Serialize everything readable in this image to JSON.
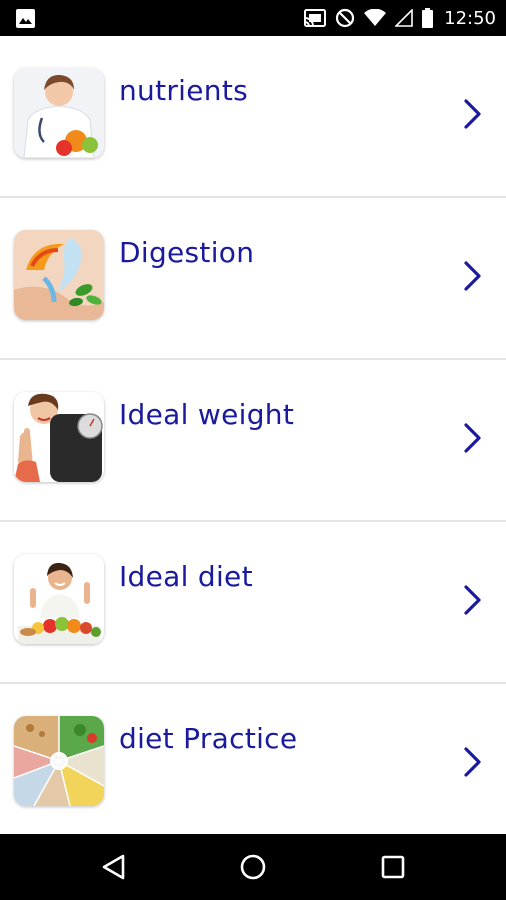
{
  "status_bar": {
    "time": "12:50",
    "icons": [
      "image-notification-icon",
      "cast-icon",
      "do-not-disturb-icon",
      "wifi-icon",
      "signal-icon",
      "battery-icon"
    ]
  },
  "list": {
    "items": [
      {
        "label": "nutrients",
        "icon": "doctor-fruit-icon"
      },
      {
        "label": "Digestion",
        "icon": "digestion-icon"
      },
      {
        "label": "Ideal weight",
        "icon": "weight-scale-icon"
      },
      {
        "label": "Ideal diet",
        "icon": "diet-woman-icon"
      },
      {
        "label": "diet Practice",
        "icon": "food-collage-icon"
      }
    ],
    "accent_color": "#1a1a9e"
  },
  "nav_bar": {
    "buttons": [
      "back-icon",
      "home-icon",
      "recents-icon"
    ]
  }
}
